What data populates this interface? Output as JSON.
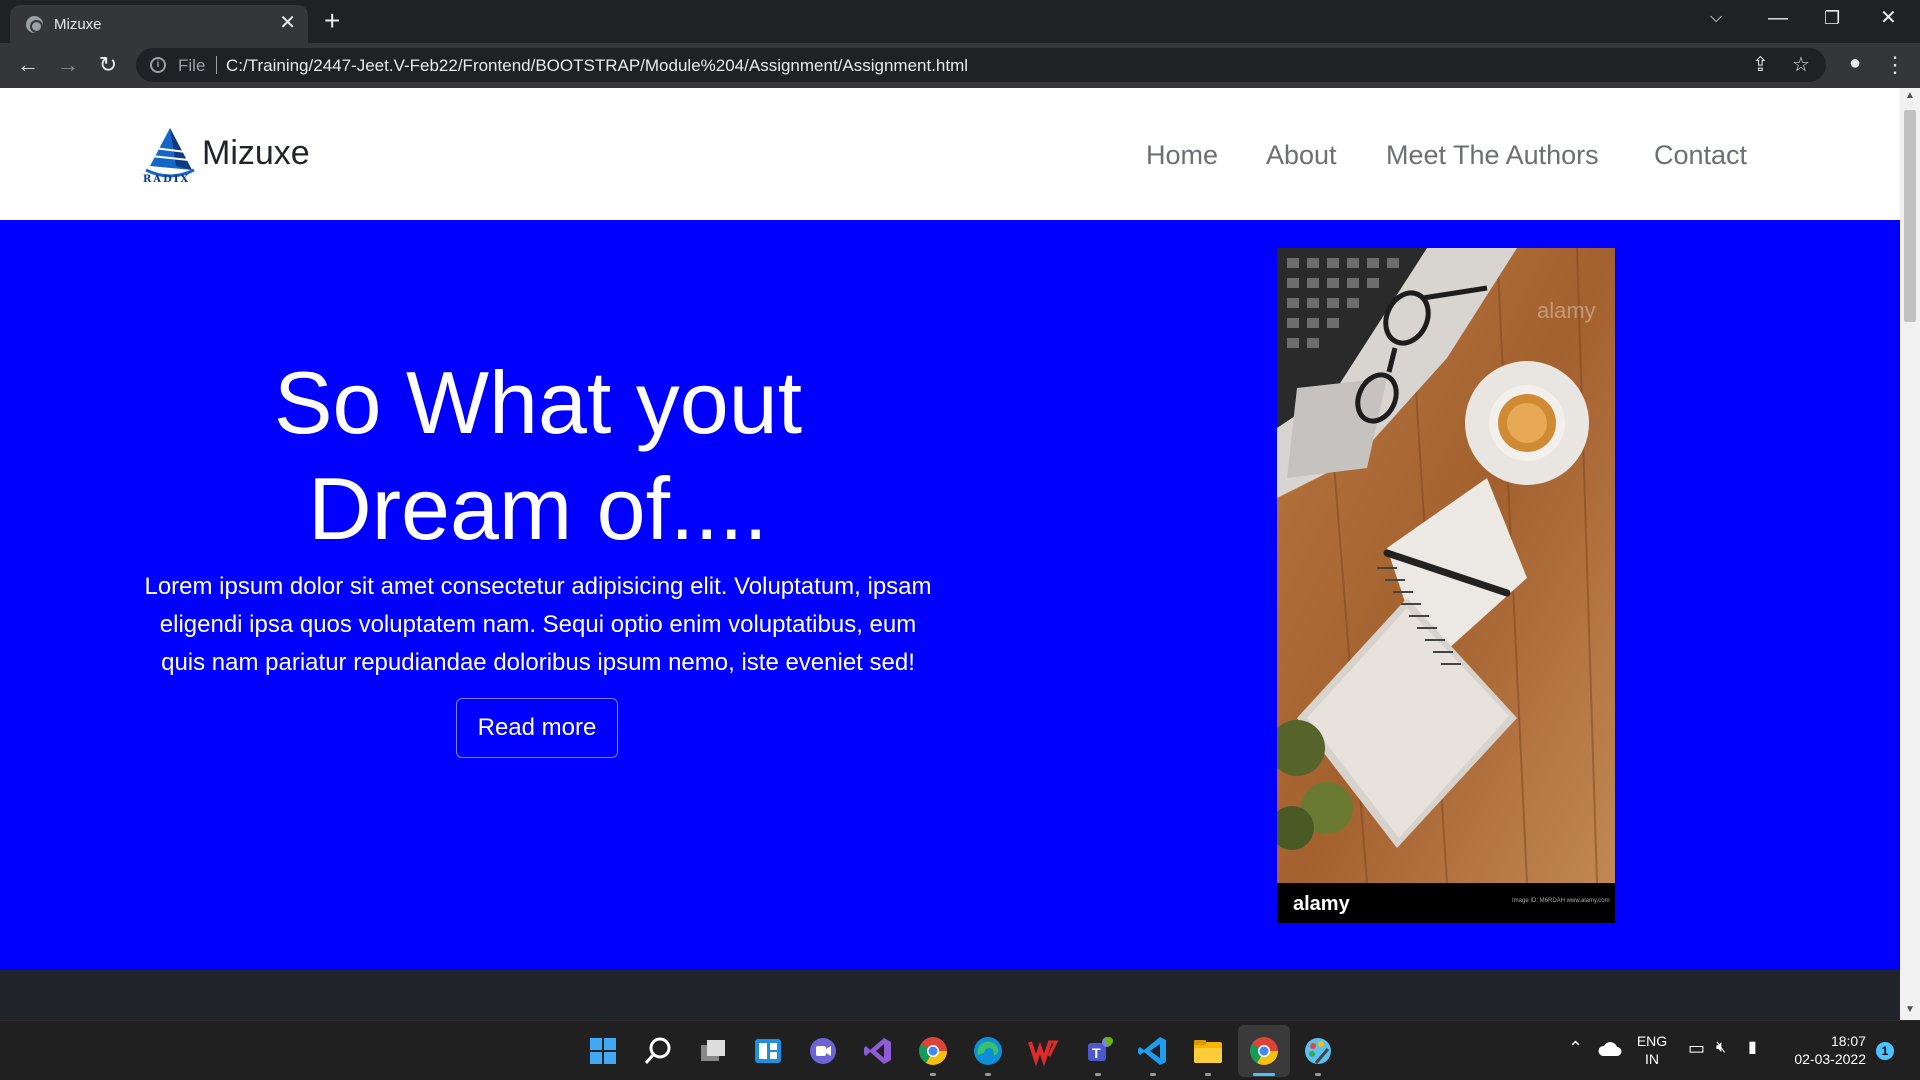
{
  "browser": {
    "tab_title": "Mizuxe",
    "file_label": "File",
    "url": "C:/Training/2447-Jeet.V-Feb22/Frontend/BOOTSTRAP/Module%204/Assignment/Assignment.html"
  },
  "navbar": {
    "brand": "Mizuxe",
    "logo_sub": "RADIX",
    "links": [
      "Home",
      "About",
      "Meet The Authors",
      "Contact"
    ]
  },
  "hero": {
    "title": "So What yout Dream of....",
    "text": "Lorem ipsum dolor sit amet consectetur adipisicing elit. Voluptatum, ipsam eligendi ipsa quos voluptatem nam. Sequi optio enim voluptatibus, eum quis nam pariatur repudiandae doloribus ipsum nemo, iste eveniet sed!",
    "button": "Read more",
    "background": "#0000ff",
    "image_watermark": "alamy",
    "image_caption": "Image ID: M6RDAH\nwww.alamy.com"
  },
  "taskbar": {
    "lang_top": "ENG",
    "lang_bottom": "IN",
    "time": "18:07",
    "date": "02-03-2022",
    "notification_count": "1",
    "icons": [
      "windows-start-icon",
      "search-icon",
      "task-view-icon",
      "widgets-icon",
      "chat-icon",
      "visual-studio-icon",
      "chrome-icon",
      "edge-icon",
      "wps-office-icon",
      "teams-icon",
      "vscode-icon",
      "file-explorer-icon",
      "chrome-active-icon",
      "paint-icon"
    ]
  }
}
